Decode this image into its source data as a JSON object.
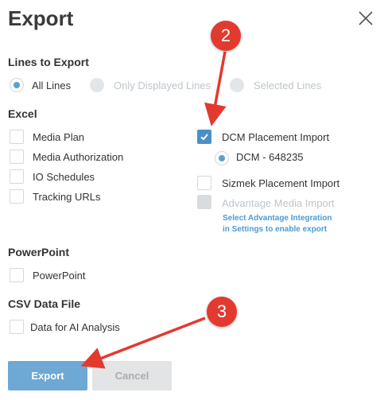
{
  "dialog": {
    "title": "Export"
  },
  "lines_to_export": {
    "heading": "Lines to Export",
    "options": [
      {
        "label": "All Lines",
        "selected": true
      },
      {
        "label": "Only Displayed Lines",
        "selected": false,
        "disabled": true
      },
      {
        "label": "Selected Lines",
        "selected": false,
        "disabled": true
      }
    ]
  },
  "excel": {
    "heading": "Excel",
    "left_items": [
      "Media Plan",
      "Media Authorization",
      "IO Schedules",
      "Tracking URLs"
    ],
    "dcm": {
      "label": "DCM Placement Import",
      "checked": true,
      "sub_option": "DCM - 648235"
    },
    "sizmek": {
      "label": "Sizmek Placement Import",
      "checked": false
    },
    "advantage": {
      "label": "Advantage Media Import",
      "disabled": true,
      "note_line1": "Select Advantage Integration",
      "note_line2": "in Settings to enable export"
    }
  },
  "powerpoint": {
    "heading": "PowerPoint",
    "item": "PowerPoint"
  },
  "csv": {
    "heading": "CSV Data File",
    "item": "Data for AI Analysis"
  },
  "buttons": {
    "export": "Export",
    "cancel": "Cancel"
  },
  "annotations": {
    "badge_2": "2",
    "badge_3": "3"
  },
  "colors": {
    "accent": "#4a90c8",
    "annotation": "#e23a2f"
  }
}
